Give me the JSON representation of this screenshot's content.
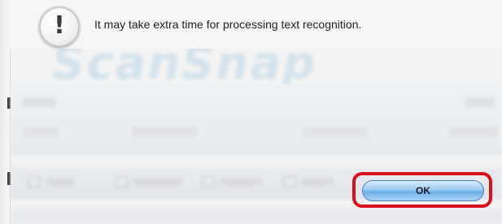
{
  "alert": {
    "icon": "exclamation-icon",
    "icon_glyph": "!",
    "message": "It may take extra time for processing text recognition.",
    "ok_label": "OK"
  },
  "background_app": {
    "logo_text": "ScanSnap"
  },
  "colors": {
    "highlight_ring": "#d90f1a",
    "button_blue": "#8fc2f0"
  }
}
